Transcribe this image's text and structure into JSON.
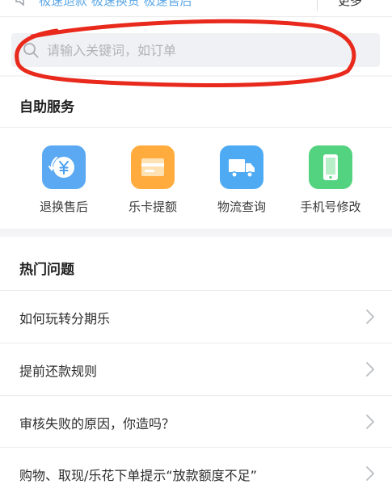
{
  "top_notice": {
    "text": "极速退款  极速换货  极速售后",
    "right_text": "更多"
  },
  "search": {
    "placeholder": "请输入关键词，如订单",
    "value": ""
  },
  "self_service": {
    "title": "自助服务",
    "items": [
      {
        "label": "退换售后",
        "icon": "refund-yuan-icon",
        "color": "#4a9ff0"
      },
      {
        "label": "乐卡提额",
        "icon": "card-icon",
        "color": "#ffa733"
      },
      {
        "label": "物流查询",
        "icon": "delivery-truck-icon",
        "color": "#4aa8f0"
      },
      {
        "label": "手机号修改",
        "icon": "mobile-phone-icon",
        "color": "#4cd07a"
      }
    ]
  },
  "hot_questions": {
    "title": "热门问题",
    "items": [
      {
        "label": "如何玩转分期乐"
      },
      {
        "label": "提前还款规则"
      },
      {
        "label": "审核失败的原因，你造吗？"
      },
      {
        "label": "购物、取现/乐花下单提示“放款额度不足”"
      }
    ]
  },
  "colors": {
    "annotation_red": "#e8291c",
    "background": "#f4f4f6"
  }
}
